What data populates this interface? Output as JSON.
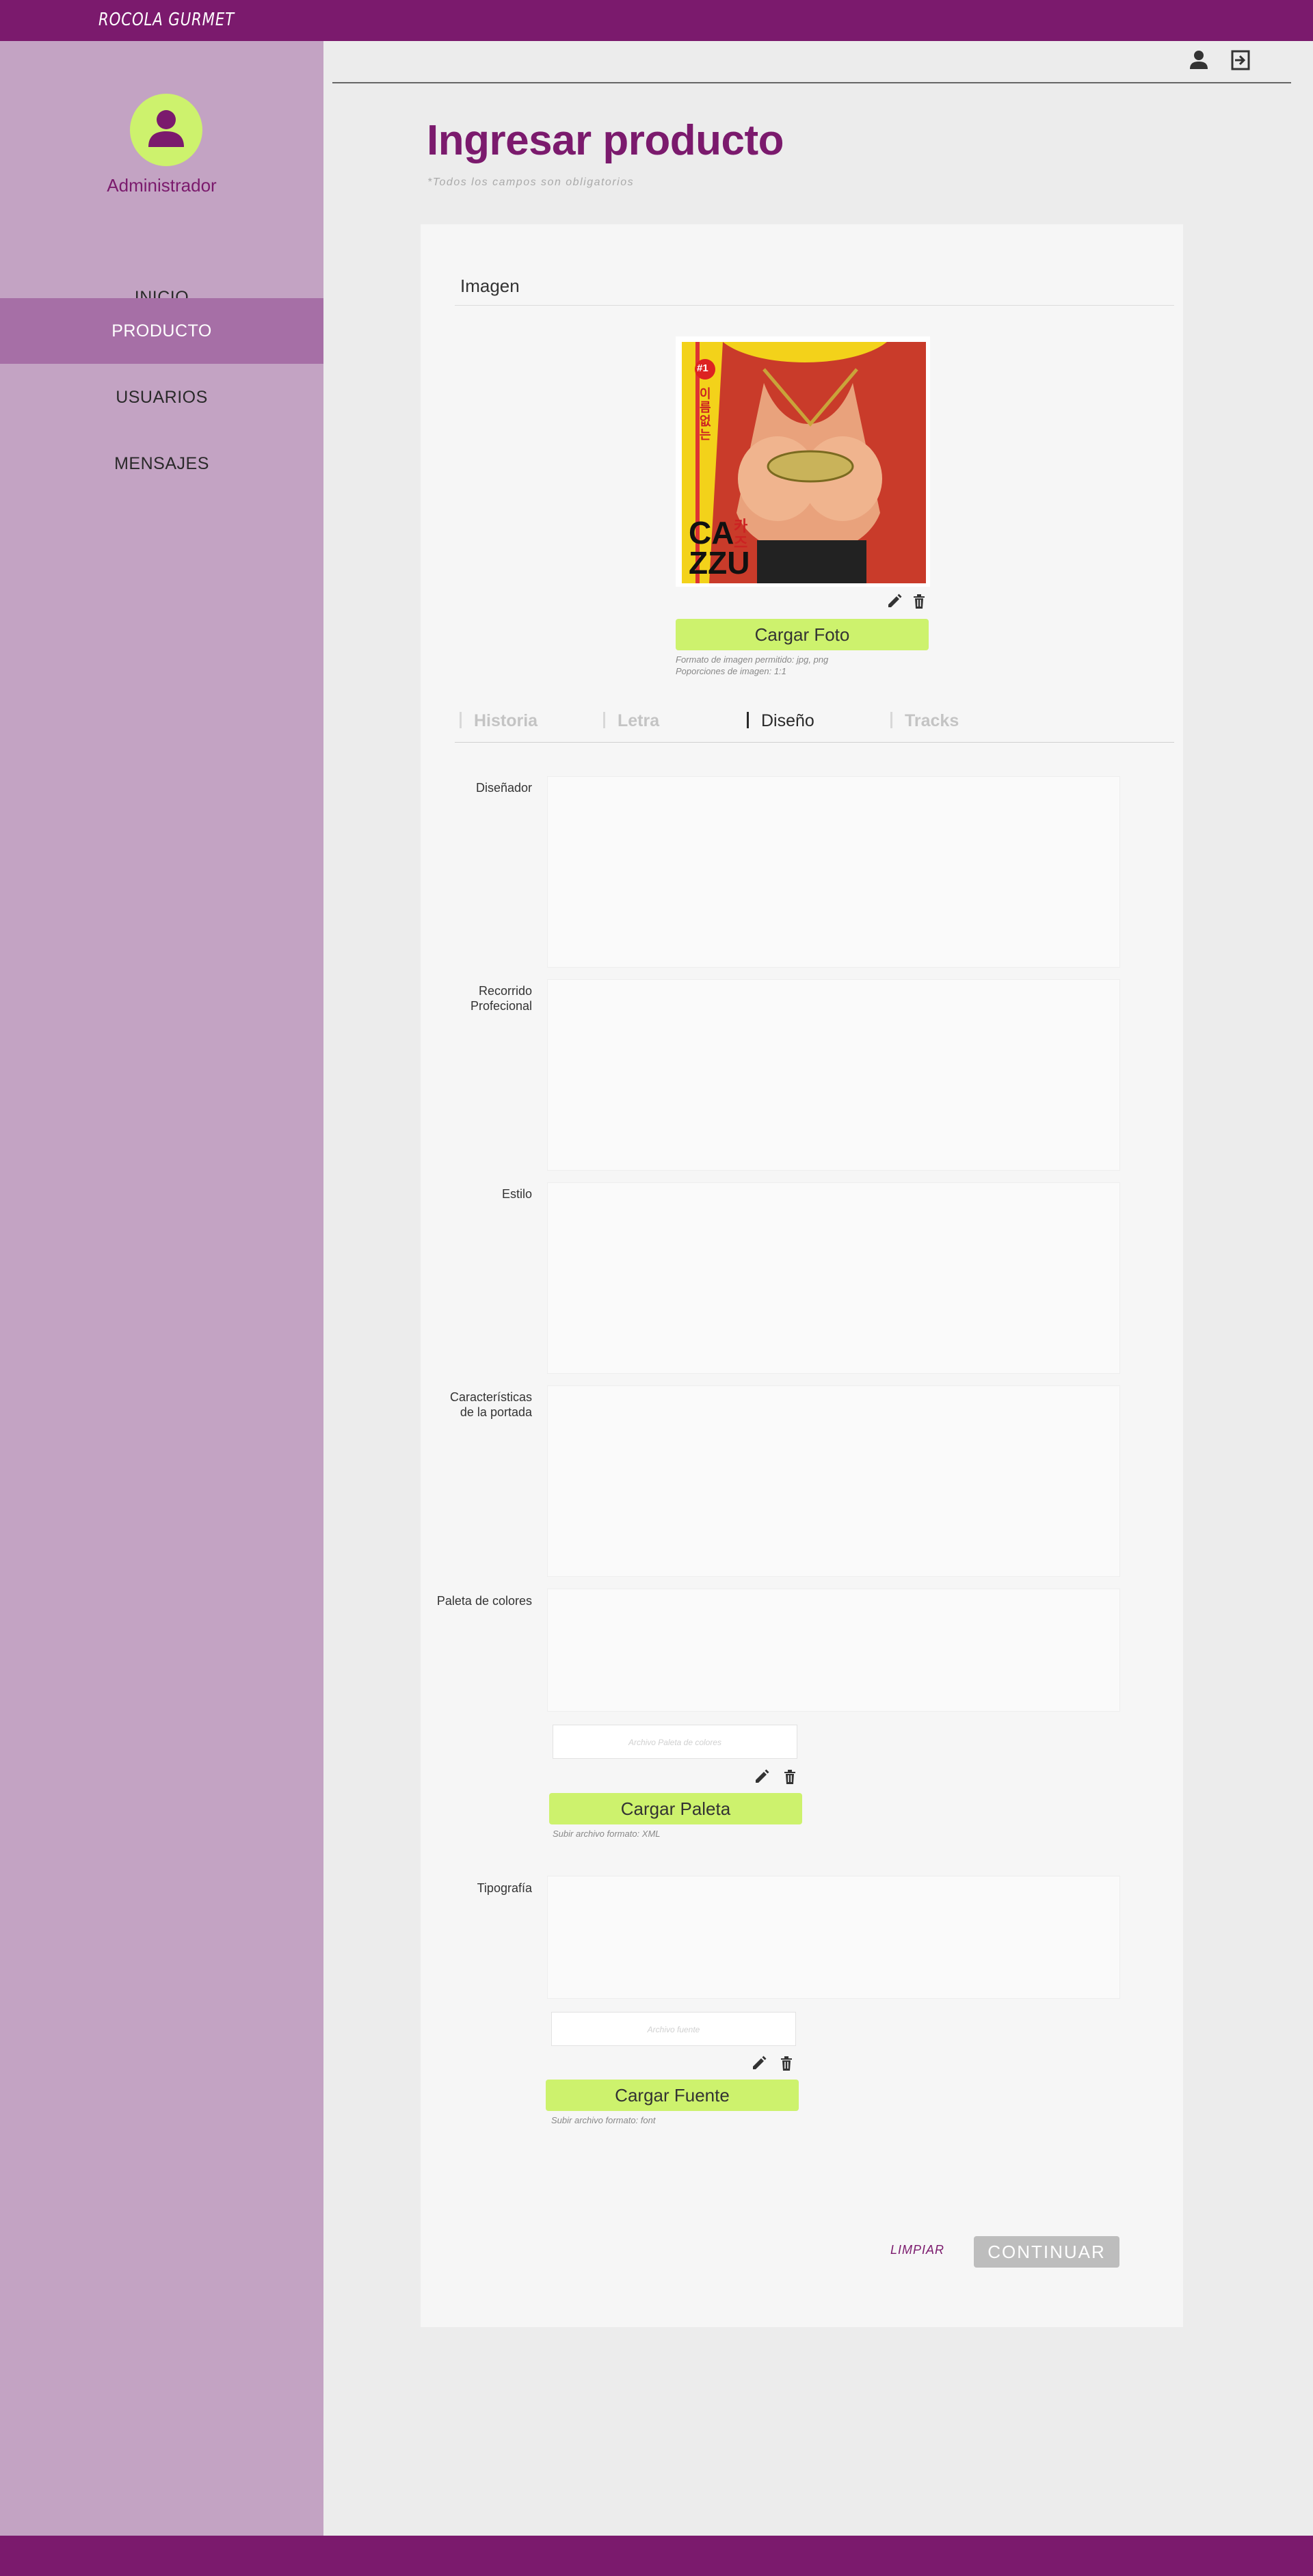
{
  "app": {
    "brand": "ROCOLA GURMET"
  },
  "sidebar": {
    "role": "Administrador",
    "items": [
      {
        "label": "INICIO",
        "active": false
      },
      {
        "label": "PRODUCTO",
        "active": true
      },
      {
        "label": "USUARIOS",
        "active": false
      },
      {
        "label": "MENSAJES",
        "active": false
      }
    ]
  },
  "header": {
    "icons": [
      "user-icon",
      "logout-icon"
    ]
  },
  "page": {
    "title": "Ingresar producto",
    "subtitle": "*Todos los campos son obligatorios"
  },
  "image_section": {
    "title": "Imagen",
    "cover_text": {
      "badge": "#1",
      "line1": "CA",
      "line2": "ZZU",
      "korean": "이름없는",
      "side": "카즈"
    },
    "upload_label": "Cargar Foto",
    "hint_line1": "Formato de imagen permitido: jpg, png",
    "hint_line2": "Poporciones de imagen: 1:1"
  },
  "tabs": [
    {
      "label": "Historia",
      "active": false
    },
    {
      "label": "Letra",
      "active": false
    },
    {
      "label": "Diseño",
      "active": true
    },
    {
      "label": "Tracks",
      "active": false
    }
  ],
  "fields": {
    "designer": {
      "label": "Diseñador",
      "value": ""
    },
    "career_line1": "Recorrido",
    "career_line2": "Profecional",
    "style": {
      "label": "Estilo",
      "value": ""
    },
    "cover_features_line1": "Características",
    "cover_features_line2": "de la portada",
    "palette": {
      "label": "Paleta de colores",
      "file_placeholder": "Archivo Paleta de colores",
      "upload_label": "Cargar Paleta",
      "hint": "Subir archivo formato: XML"
    },
    "typography": {
      "label": "Tipografía",
      "file_placeholder": "Archivo fuente",
      "upload_label": "Cargar Fuente",
      "hint": "Subir archivo formato: font"
    }
  },
  "actions": {
    "clear": "LIMPIAR",
    "continue": "CONTINUAR"
  },
  "colors": {
    "brand": "#7b1a6d",
    "accent": "#cdf26d",
    "sidebar": "#c3a3c3",
    "active_nav": "#a66fa6"
  }
}
